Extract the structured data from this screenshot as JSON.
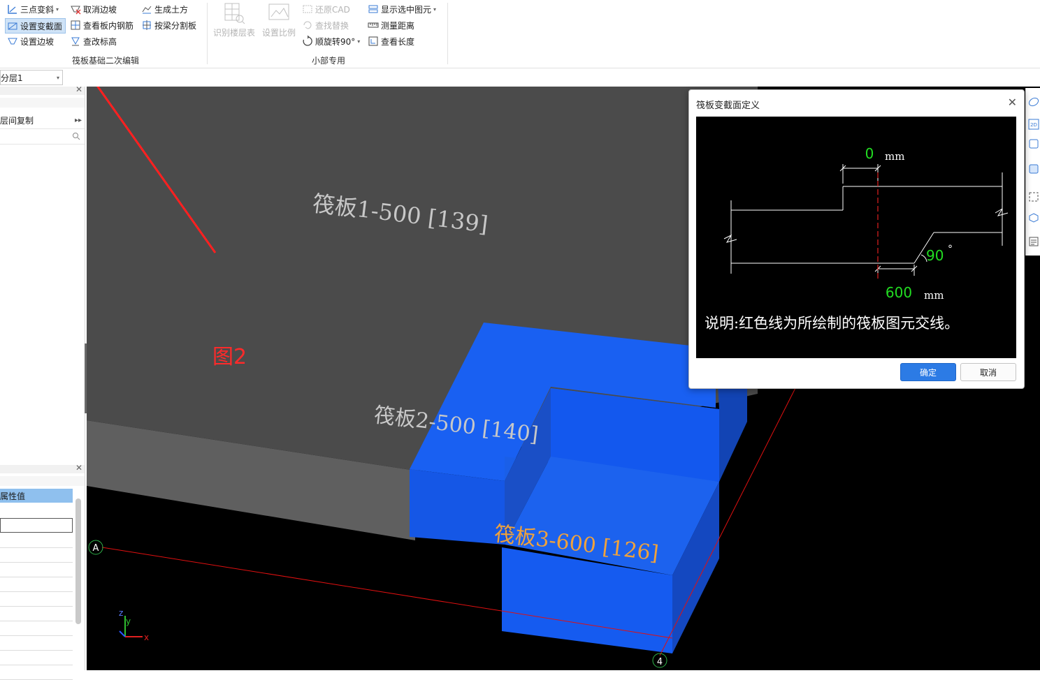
{
  "ribbon": {
    "group1": {
      "btn_three_point_slope": "三点变斜",
      "btn_set_section": "设置变截面",
      "btn_set_slope_edge": "设置边坡",
      "btn_cancel_slope_edge": "取消边坡",
      "btn_view_inner_rebar": "查看板内钢筋",
      "btn_change_elevation": "查改标高",
      "btn_generate_earthwork": "生成土方",
      "btn_split_by_beam": "按梁分割板",
      "label": "筏板基础二次编辑"
    },
    "group2": {
      "btn_identify_floor_table": "识别楼层表",
      "btn_set_scale": "设置比例",
      "btn_restore_cad": "还原CAD",
      "btn_find_replace": "查找替换",
      "btn_rotate_cw_90": "顺旋转90°",
      "btn_show_selected": "显示选中图元",
      "btn_measure_distance": "测量距离",
      "btn_view_length": "查看长度",
      "label": "小部专用"
    }
  },
  "floor_select": {
    "value": "分层1"
  },
  "left_panel": {
    "tab_copy_label": "层间复制",
    "property_header": "属性值"
  },
  "viewport": {
    "slab1_label": "筏板1-500 [139]",
    "slab2_label": "筏板2-500 [140]",
    "slab3_label": "筏板3-600 [126]",
    "annotation_note": "图2",
    "axis_a": "A",
    "axis_4": "4",
    "axis_x": "x",
    "axis_y": "y",
    "axis_z": "z",
    "colors": {
      "slab_grey": "#4a4a4a",
      "slab_blue": "#1560f0",
      "label_grey": "#c9c9c9",
      "label_orange": "#f0a23c",
      "note_red": "#ff2a2a"
    }
  },
  "dialog": {
    "title": "筏板变截面定义",
    "top_value": "0",
    "top_unit": "mm",
    "angle_value": "90",
    "angle_unit": "°",
    "bottom_value": "600",
    "bottom_unit": "mm",
    "description": "说明:红色线为所绘制的筏板图元交线。",
    "ok_label": "确定",
    "cancel_label": "取消"
  }
}
